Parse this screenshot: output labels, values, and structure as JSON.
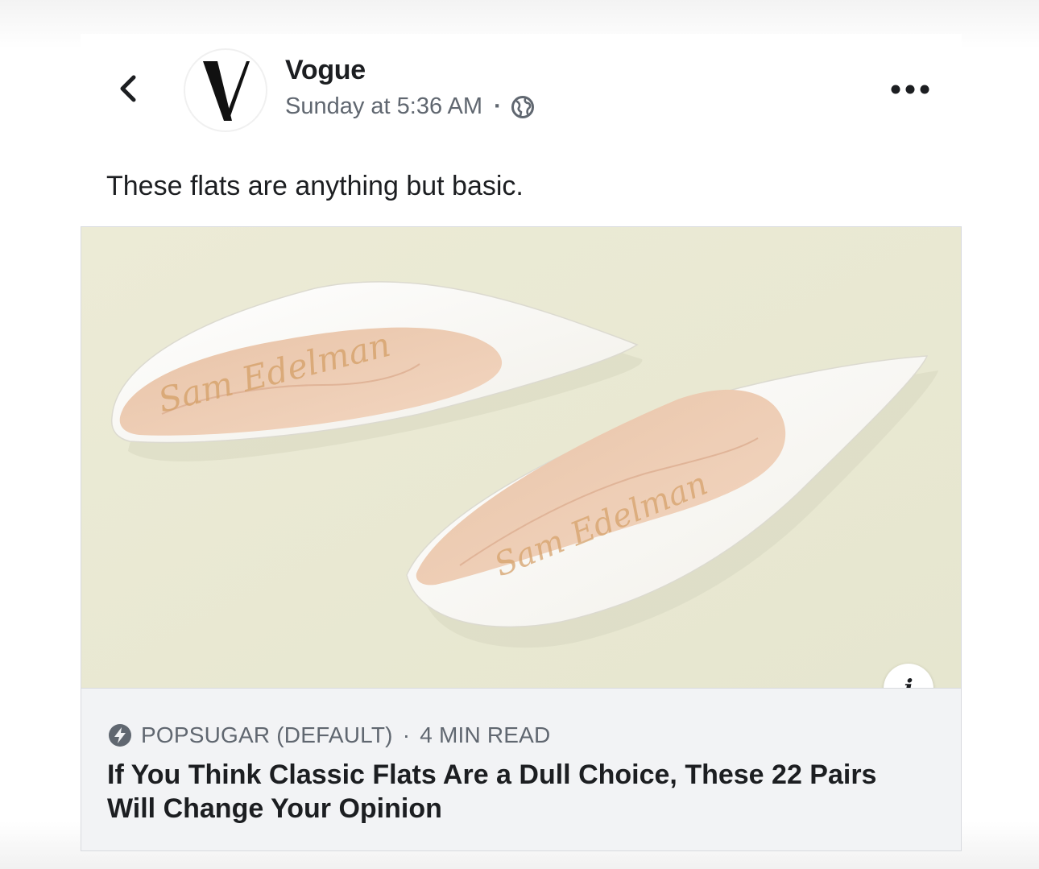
{
  "post": {
    "page_name": "Vogue",
    "timestamp": "Sunday at 5:36 AM",
    "separator": "·",
    "privacy_icon": "globe-icon",
    "more_icon": "more-horizontal-icon",
    "back_icon": "chevron-left-icon",
    "text": "These flats are anything but basic."
  },
  "link": {
    "image_alt": "white pointed-toe flats",
    "source_icon": "bolt-icon",
    "source": "POPSUGAR (DEFAULT)",
    "separator": "·",
    "read_time": "4 MIN READ",
    "headline": "If You Think Classic Flats Are a Dull Choice, These 22 Pairs Will Change Your Opinion",
    "info_icon": "info-icon",
    "info_glyph": "i"
  },
  "colors": {
    "text_primary": "#1c1e21",
    "text_secondary": "#606770",
    "footer_bg": "#f2f3f5",
    "image_bg": "#e9e9d4"
  }
}
